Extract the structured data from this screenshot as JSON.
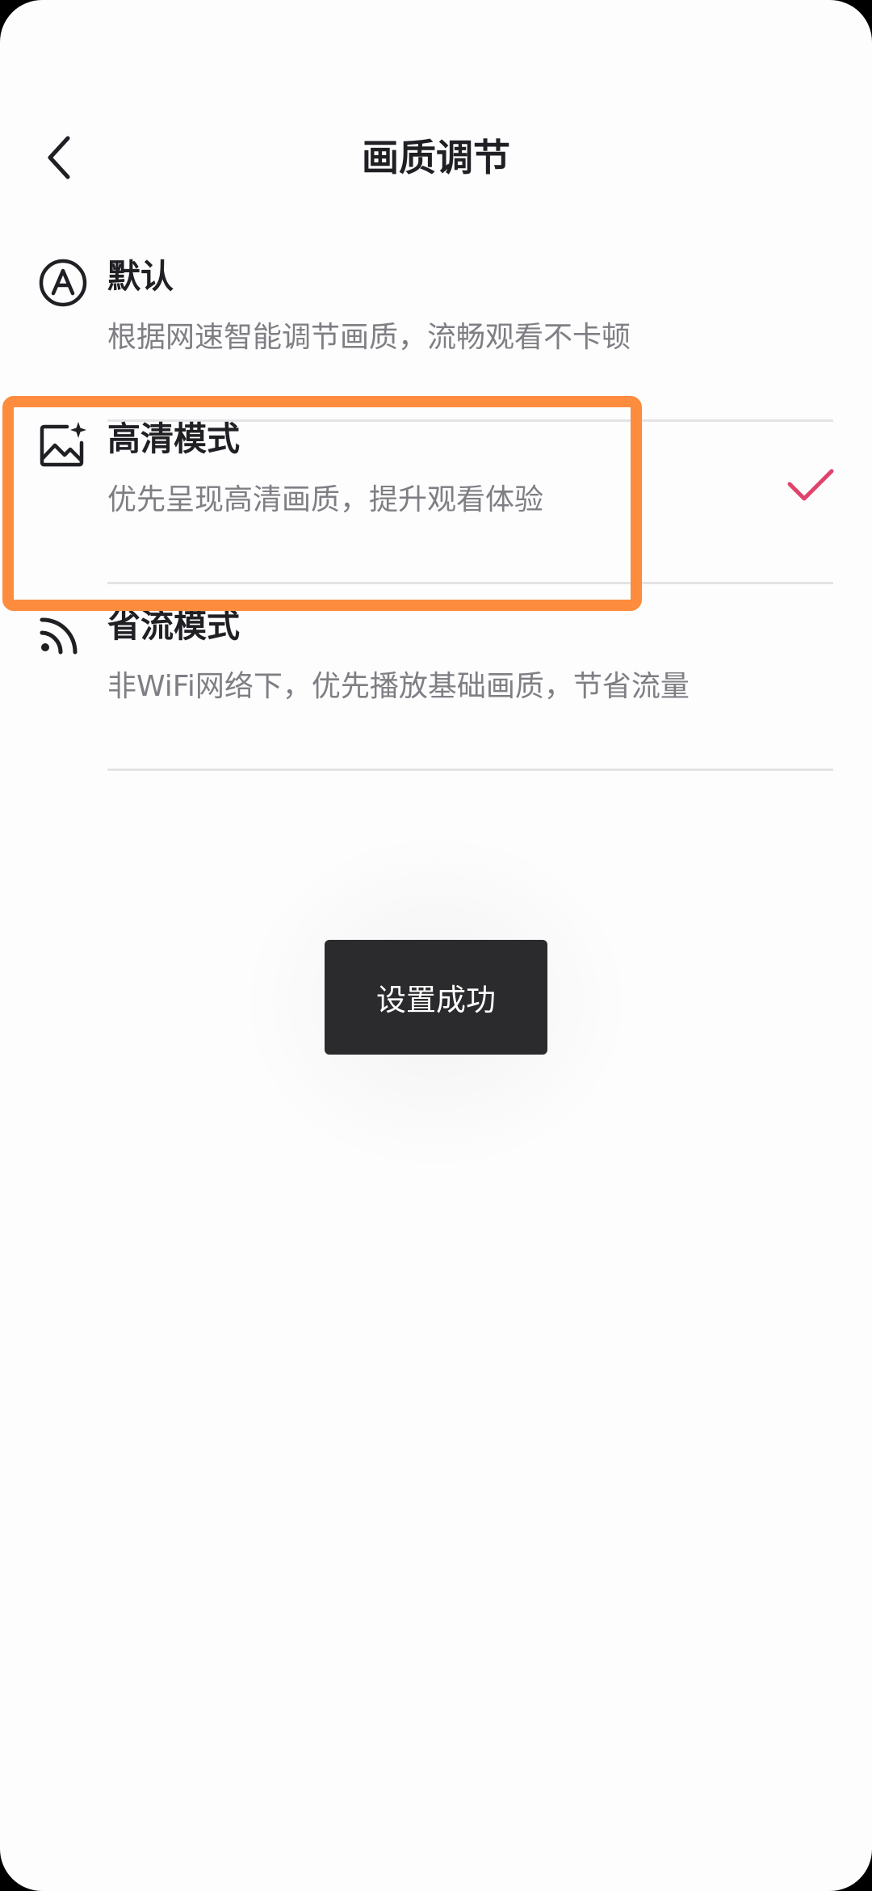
{
  "header": {
    "title": "画质调节",
    "back_icon": "chevron-left-icon"
  },
  "options": [
    {
      "icon": "auto-a-icon",
      "name": "默认",
      "description": "根据网速智能调节画质，流畅观看不卡顿",
      "selected": false
    },
    {
      "icon": "hd-image-sparkle-icon",
      "name": "高清模式",
      "description": "优先呈现高清画质，提升观看体验",
      "selected": true
    },
    {
      "icon": "data-saver-signal-icon",
      "name": "省流模式",
      "description": "非WiFi网络下，优先播放基础画质，节省流量",
      "selected": false
    }
  ],
  "toast": {
    "text": "设置成功"
  },
  "colors": {
    "check": "#e0436b",
    "highlight": "#fd8c3f",
    "toast_bg": "#2b2b2d",
    "text_primary": "#1f1f24",
    "text_secondary": "#7e7e84"
  }
}
